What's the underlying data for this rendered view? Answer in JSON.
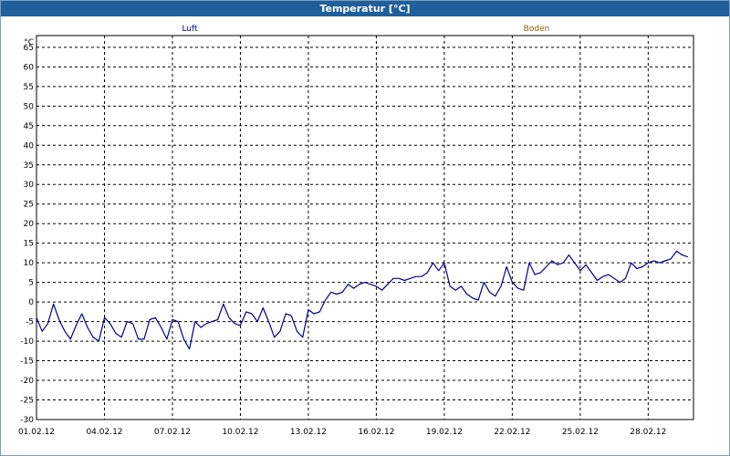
{
  "window": {
    "title": "Temperatur [°C]"
  },
  "chart_data": {
    "type": "line",
    "title": "Temperatur [°C]",
    "y_unit": "°C",
    "ylim": [
      -30,
      68
    ],
    "y_ticks": [
      65,
      60,
      55,
      50,
      45,
      40,
      35,
      30,
      25,
      20,
      15,
      10,
      5,
      0,
      -5,
      -10,
      -15,
      -20,
      -25,
      -30
    ],
    "xlim": [
      "01.02.12",
      "01.03.12"
    ],
    "x_tick_labels": [
      "01.02.12",
      "04.02.12",
      "07.02.12",
      "10.02.12",
      "13.02.12",
      "16.02.12",
      "19.02.12",
      "22.02.12",
      "25.02.12",
      "28.02.12"
    ],
    "grid": true,
    "legend_position": "top",
    "legend": [
      {
        "name": "Luft",
        "color": "#00008b"
      },
      {
        "name": "Boden",
        "color": "#9c5a00"
      }
    ],
    "series": [
      {
        "name": "Luft",
        "color": "#00008b",
        "points": [
          [
            "01.02.12 00:00",
            -4.0
          ],
          [
            "01.02.12 06:00",
            -7.5
          ],
          [
            "01.02.12 12:00",
            -5.5
          ],
          [
            "01.02.12 18:00",
            -0.5
          ],
          [
            "02.02.12 00:00",
            -4.5
          ],
          [
            "02.02.12 06:00",
            -7.5
          ],
          [
            "02.02.12 12:00",
            -9.5
          ],
          [
            "02.02.12 18:00",
            -6.0
          ],
          [
            "03.02.12 00:00",
            -3.0
          ],
          [
            "03.02.12 06:00",
            -6.5
          ],
          [
            "03.02.12 12:00",
            -9.0
          ],
          [
            "03.02.12 18:00",
            -10.0
          ],
          [
            "04.02.12 00:00",
            -4.0
          ],
          [
            "04.02.12 06:00",
            -5.5
          ],
          [
            "04.02.12 12:00",
            -8.0
          ],
          [
            "04.02.12 18:00",
            -9.0
          ],
          [
            "05.02.12 00:00",
            -5.0
          ],
          [
            "05.02.12 06:00",
            -5.5
          ],
          [
            "05.02.12 12:00",
            -9.5
          ],
          [
            "05.02.12 18:00",
            -9.5
          ],
          [
            "06.02.12 00:00",
            -4.5
          ],
          [
            "06.02.12 06:00",
            -4.0
          ],
          [
            "06.02.12 12:00",
            -6.5
          ],
          [
            "06.02.12 18:00",
            -9.5
          ],
          [
            "07.02.12 00:00",
            -4.5
          ],
          [
            "07.02.12 06:00",
            -5.0
          ],
          [
            "07.02.12 12:00",
            -9.5
          ],
          [
            "07.02.12 18:00",
            -12.0
          ],
          [
            "08.02.12 00:00",
            -5.0
          ],
          [
            "08.02.12 06:00",
            -6.5
          ],
          [
            "08.02.12 12:00",
            -5.5
          ],
          [
            "08.02.12 18:00",
            -5.0
          ],
          [
            "09.02.12 00:00",
            -4.5
          ],
          [
            "09.02.12 06:00",
            -0.5
          ],
          [
            "09.02.12 12:00",
            -4.0
          ],
          [
            "09.02.12 18:00",
            -5.5
          ],
          [
            "10.02.12 00:00",
            -6.0
          ],
          [
            "10.02.12 06:00",
            -2.5
          ],
          [
            "10.02.12 12:00",
            -3.0
          ],
          [
            "10.02.12 18:00",
            -5.0
          ],
          [
            "11.02.12 00:00",
            -1.5
          ],
          [
            "11.02.12 06:00",
            -5.0
          ],
          [
            "11.02.12 12:00",
            -9.0
          ],
          [
            "11.02.12 18:00",
            -7.5
          ],
          [
            "12.02.12 00:00",
            -3.0
          ],
          [
            "12.02.12 06:00",
            -3.5
          ],
          [
            "12.02.12 12:00",
            -7.5
          ],
          [
            "12.02.12 18:00",
            -9.0
          ],
          [
            "13.02.12 00:00",
            -2.0
          ],
          [
            "13.02.12 06:00",
            -3.0
          ],
          [
            "13.02.12 12:00",
            -2.5
          ],
          [
            "13.02.12 18:00",
            0.5
          ],
          [
            "14.02.12 00:00",
            2.5
          ],
          [
            "14.02.12 06:00",
            2.0
          ],
          [
            "14.02.12 12:00",
            2.5
          ],
          [
            "14.02.12 18:00",
            4.5
          ],
          [
            "15.02.12 00:00",
            3.5
          ],
          [
            "15.02.12 06:00",
            4.5
          ],
          [
            "15.02.12 12:00",
            5.0
          ],
          [
            "15.02.12 18:00",
            4.5
          ],
          [
            "16.02.12 00:00",
            4.0
          ],
          [
            "16.02.12 06:00",
            3.0
          ],
          [
            "16.02.12 12:00",
            4.5
          ],
          [
            "16.02.12 18:00",
            6.0
          ],
          [
            "17.02.12 00:00",
            6.0
          ],
          [
            "17.02.12 06:00",
            5.5
          ],
          [
            "17.02.12 12:00",
            6.0
          ],
          [
            "17.02.12 18:00",
            6.5
          ],
          [
            "18.02.12 00:00",
            6.5
          ],
          [
            "18.02.12 06:00",
            7.5
          ],
          [
            "18.02.12 12:00",
            10.0
          ],
          [
            "18.02.12 18:00",
            8.0
          ],
          [
            "19.02.12 00:00",
            10.0
          ],
          [
            "19.02.12 06:00",
            4.0
          ],
          [
            "19.02.12 12:00",
            3.0
          ],
          [
            "19.02.12 18:00",
            4.0
          ],
          [
            "20.02.12 00:00",
            2.0
          ],
          [
            "20.02.12 06:00",
            1.0
          ],
          [
            "20.02.12 12:00",
            0.5
          ],
          [
            "20.02.12 18:00",
            5.0
          ],
          [
            "21.02.12 00:00",
            2.5
          ],
          [
            "21.02.12 06:00",
            1.5
          ],
          [
            "21.02.12 12:00",
            4.0
          ],
          [
            "21.02.12 18:00",
            9.0
          ],
          [
            "22.02.12 00:00",
            5.0
          ],
          [
            "22.02.12 06:00",
            3.5
          ],
          [
            "22.02.12 12:00",
            3.0
          ],
          [
            "22.02.12 18:00",
            10.0
          ],
          [
            "23.02.12 00:00",
            7.0
          ],
          [
            "23.02.12 06:00",
            7.5
          ],
          [
            "23.02.12 12:00",
            9.0
          ],
          [
            "23.02.12 18:00",
            10.5
          ],
          [
            "24.02.12 00:00",
            9.5
          ],
          [
            "24.02.12 06:00",
            10.0
          ],
          [
            "24.02.12 12:00",
            12.0
          ],
          [
            "24.02.12 18:00",
            10.0
          ],
          [
            "25.02.12 00:00",
            8.0
          ],
          [
            "25.02.12 06:00",
            9.5
          ],
          [
            "25.02.12 12:00",
            7.5
          ],
          [
            "25.02.12 18:00",
            5.5
          ],
          [
            "26.02.12 00:00",
            6.5
          ],
          [
            "26.02.12 06:00",
            7.0
          ],
          [
            "26.02.12 12:00",
            6.0
          ],
          [
            "26.02.12 18:00",
            5.0
          ],
          [
            "27.02.12 00:00",
            6.0
          ],
          [
            "27.02.12 06:00",
            10.0
          ],
          [
            "27.02.12 12:00",
            8.5
          ],
          [
            "27.02.12 18:00",
            9.0
          ],
          [
            "28.02.12 00:00",
            10.0
          ],
          [
            "28.02.12 06:00",
            10.5
          ],
          [
            "28.02.12 12:00",
            10.0
          ],
          [
            "28.02.12 18:00",
            10.5
          ],
          [
            "29.02.12 00:00",
            11.0
          ],
          [
            "29.02.12 06:00",
            13.0
          ],
          [
            "29.02.12 12:00",
            12.0
          ],
          [
            "29.02.12 18:00",
            11.5
          ]
        ]
      }
    ]
  }
}
